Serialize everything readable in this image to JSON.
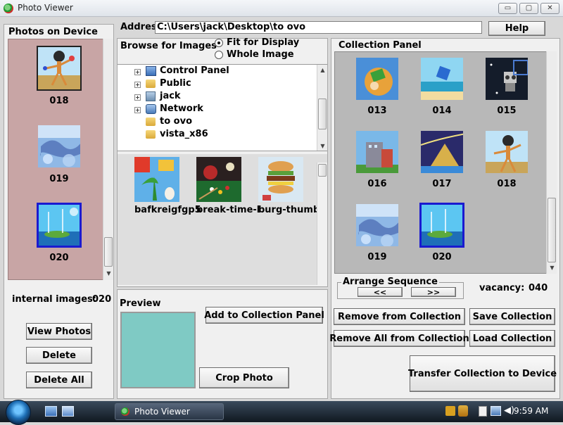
{
  "window": {
    "title": "Photo Viewer",
    "minimize": "▭",
    "maximize": "▢",
    "close": "✕"
  },
  "left_panel": {
    "title": "Photos on Device",
    "photos": [
      {
        "label": "018",
        "selected": false
      },
      {
        "label": "019",
        "selected": false
      },
      {
        "label": "020",
        "selected": true
      }
    ],
    "internal_label": "internal images:",
    "internal_value": "020",
    "buttons": {
      "view": "View Photos",
      "delete": "Delete",
      "delete_all": "Delete All"
    }
  },
  "address": {
    "label": "Addres",
    "value": "C:\\Users\\jack\\Desktop\\to ovo",
    "help": "Help"
  },
  "browse": {
    "label": "Browse for Images",
    "options": [
      {
        "label": "Fit for Display",
        "checked": true
      },
      {
        "label": "Whole Image",
        "checked": false
      }
    ],
    "tree": [
      {
        "label": "Control Panel",
        "icon": "control-panel-icon",
        "expandable": true
      },
      {
        "label": "Public",
        "icon": "folder-icon",
        "expandable": true
      },
      {
        "label": "jack",
        "icon": "user-folder-icon",
        "expandable": true
      },
      {
        "label": "Network",
        "icon": "network-icon",
        "expandable": true
      },
      {
        "label": "to ovo",
        "icon": "folder-icon",
        "expandable": false
      },
      {
        "label": "vista_x86",
        "icon": "folder-icon",
        "expandable": false
      }
    ],
    "files": [
      {
        "label": "bafkreigfgp5"
      },
      {
        "label": "break-time-l"
      },
      {
        "label": "burg-thumb.j"
      }
    ]
  },
  "preview": {
    "label": "Preview",
    "add_button": "Add to Collection Panel",
    "crop_button": "Crop Photo",
    "color": "#7fcac4"
  },
  "collection": {
    "title": "Collection Panel",
    "items": [
      {
        "label": "013",
        "selected": false
      },
      {
        "label": "014",
        "selected": false
      },
      {
        "label": "015",
        "selected": false
      },
      {
        "label": "016",
        "selected": false
      },
      {
        "label": "017",
        "selected": false
      },
      {
        "label": "018",
        "selected": false
      },
      {
        "label": "019",
        "selected": false
      },
      {
        "label": "020",
        "selected": true
      }
    ],
    "arrange_label": "Arrange Sequence",
    "prev": "<<",
    "next": ">>",
    "vacancy_label": "vacancy:",
    "vacancy_value": "040",
    "buttons": {
      "remove": "Remove from Collection",
      "save": "Save Collection",
      "remove_all": "Remove All from Collection",
      "load": "Load Collection",
      "transfer": "Transfer Collection to Device"
    }
  },
  "taskbar": {
    "app": "Photo Viewer",
    "time": "9:59 AM"
  },
  "colors": {
    "left_bg": "#c8a5a5",
    "collection_bg": "#b8b8b8",
    "selection": "#1a1ad0"
  }
}
